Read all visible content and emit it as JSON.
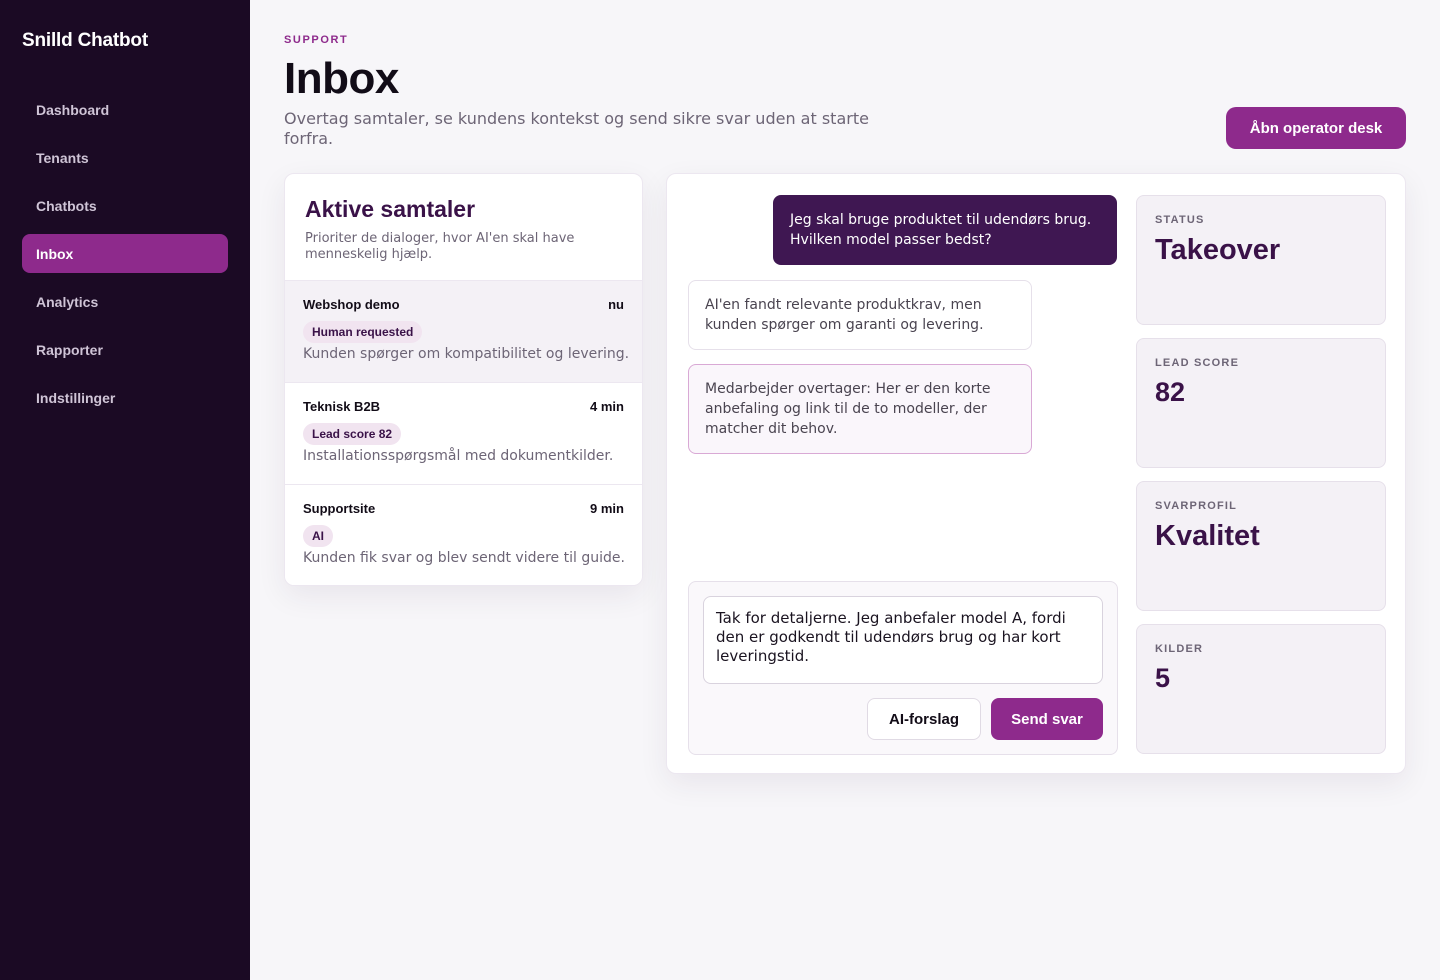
{
  "sidebar": {
    "brand": "Snilld Chatbot",
    "items": [
      {
        "label": "Dashboard"
      },
      {
        "label": "Tenants"
      },
      {
        "label": "Chatbots"
      },
      {
        "label": "Inbox"
      },
      {
        "label": "Analytics"
      },
      {
        "label": "Rapporter"
      },
      {
        "label": "Indstillinger"
      }
    ],
    "active": "Inbox"
  },
  "header": {
    "eyebrow": "SUPPORT",
    "title": "Inbox",
    "subtitle": "Overtag samtaler, se kundens kontekst og send sikre svar uden at starte forfra.",
    "operator_button": "Åbn operator desk"
  },
  "conversations": {
    "title": "Aktive samtaler",
    "description": "Prioriter de dialoger, hvor AI'en skal have menneskelig hjælp.",
    "items": [
      {
        "name": "Webshop demo",
        "time": "nu",
        "badge": "Human requested",
        "summary": "Kunden spørger om kompatibilitet og levering."
      },
      {
        "name": "Teknisk B2B",
        "time": "4 min",
        "badge": "Lead score 82",
        "summary": "Installationsspørgsmål med dokumentkilder."
      },
      {
        "name": "Supportsite",
        "time": "9 min",
        "badge": "AI",
        "summary": "Kunden fik svar og blev sendt videre til guide."
      }
    ]
  },
  "chat": {
    "messages": [
      {
        "role": "user",
        "text": "Jeg skal bruge produktet til udendørs brug. Hvilken model passer bedst?"
      },
      {
        "role": "ai",
        "text": "AI'en fandt relevante produktkrav, men kunden spørger om garanti og levering."
      },
      {
        "role": "agent",
        "text": "Medarbejder overtager: Her er den korte anbefaling og link til de to modeller, der matcher dit behov."
      }
    ],
    "reply_value": "Tak for detaljerne. Jeg anbefaler model A, fordi den er godkendt til udendørs brug og har kort leveringstid.",
    "ai_button": "AI-forslag",
    "send_button": "Send svar"
  },
  "stats": [
    {
      "label": "STATUS",
      "value": "Takeover"
    },
    {
      "label": "LEAD SCORE",
      "value": "82"
    },
    {
      "label": "SVARPROFIL",
      "value": "Kvalitet"
    },
    {
      "label": "KILDER",
      "value": "5"
    }
  ],
  "colors": {
    "sidebar_bg": "#1b0a24",
    "accent": "#8e2a8c",
    "user_bubble": "#3f1752",
    "heading": "#3a1248"
  }
}
